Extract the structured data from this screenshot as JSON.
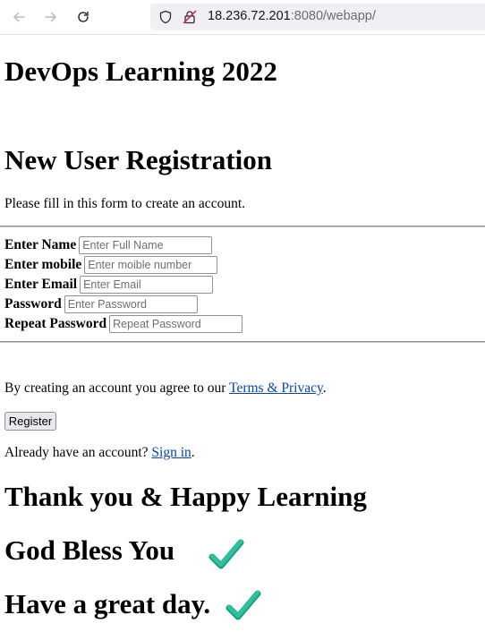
{
  "browser": {
    "url_host": "18.236.72.201",
    "url_rest": ":8080/webapp/"
  },
  "page": {
    "title": "DevOps Learning 2022",
    "form_heading": "New User Registration",
    "form_intro": "Please fill in this form to create an account.",
    "fields": [
      {
        "label": "Enter Name",
        "placeholder": "Enter Full Name"
      },
      {
        "label": "Enter mobile",
        "placeholder": "Enter moible number"
      },
      {
        "label": "Enter Email",
        "placeholder": "Enter Email"
      },
      {
        "label": "Password",
        "placeholder": "Enter Password"
      },
      {
        "label": "Repeat Password",
        "placeholder": "Repeat Password"
      }
    ],
    "terms_prefix": "By creating an account you agree to our ",
    "terms_link": "Terms & Privacy",
    "terms_suffix": ".",
    "register_label": "Register",
    "signin_prefix": "Already have an account? ",
    "signin_link": "Sign in",
    "signin_suffix": ".",
    "thanks": "Thank you & Happy Learning",
    "blessing": "God Bless You",
    "farewell": "Have a great day."
  },
  "colors": {
    "link": "#0645ad",
    "checkmark": "#26b394"
  },
  "icons": [
    "back-arrow-icon",
    "forward-arrow-icon",
    "reload-icon",
    "shield-icon",
    "insecure-lock-icon",
    "checkmark-icon"
  ]
}
